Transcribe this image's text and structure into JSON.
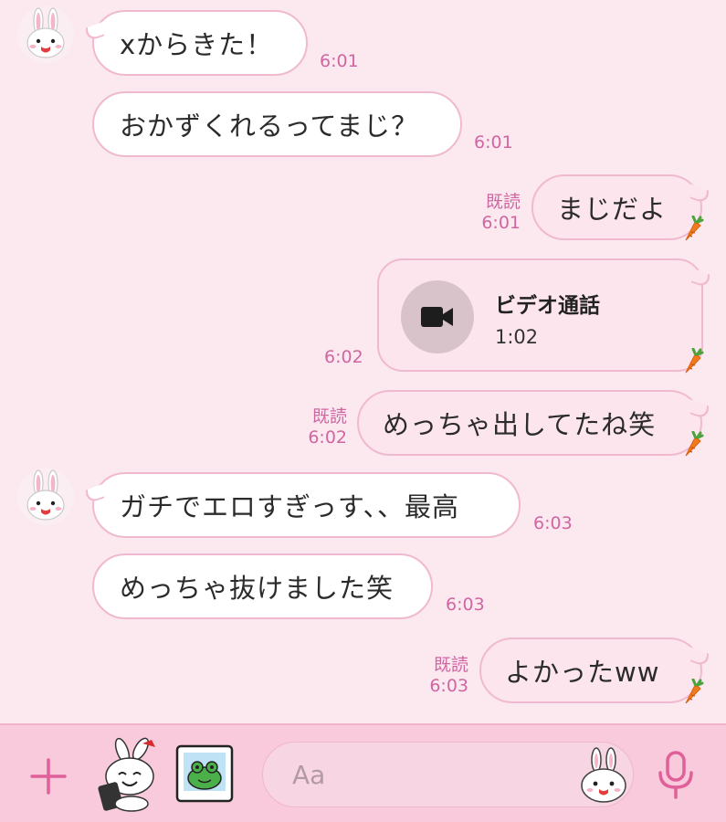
{
  "messages": [
    {
      "side": "in",
      "text": "xからきた！",
      "time": "6:01"
    },
    {
      "side": "in",
      "text": "おかずくれるってまじ？",
      "time": "6:01"
    },
    {
      "side": "out",
      "text": "まじだよ",
      "read": "既読",
      "time": "6:01"
    },
    {
      "side": "out",
      "type": "call",
      "title": "ビデオ通話",
      "duration": "1:02",
      "time": "6:02"
    },
    {
      "side": "out",
      "text": "めっちゃ出してたね笑",
      "read": "既読",
      "time": "6:02"
    },
    {
      "side": "in",
      "text": "ガチでエロすぎっす、、最高",
      "time": "6:03"
    },
    {
      "side": "in",
      "text": "めっちゃ抜けました笑",
      "time": "6:03"
    },
    {
      "side": "out",
      "text": "よかったww",
      "read": "既読",
      "time": "6:03"
    }
  ],
  "input": {
    "placeholder": "Aa"
  },
  "colors": {
    "background": "#fce9f0",
    "outgoing_bubble": "#fde5ee",
    "incoming_bubble": "#ffffff",
    "bubble_border": "#f0b9cf",
    "accent": "#e0609a",
    "meta_text": "#d066a1",
    "input_bar": "#f9cadb"
  },
  "icons": [
    "cony-avatar-icon",
    "carrot-icon",
    "video-camera-icon",
    "plus-icon",
    "sticker-icon",
    "photo-icon",
    "emoji-icon",
    "microphone-icon"
  ]
}
